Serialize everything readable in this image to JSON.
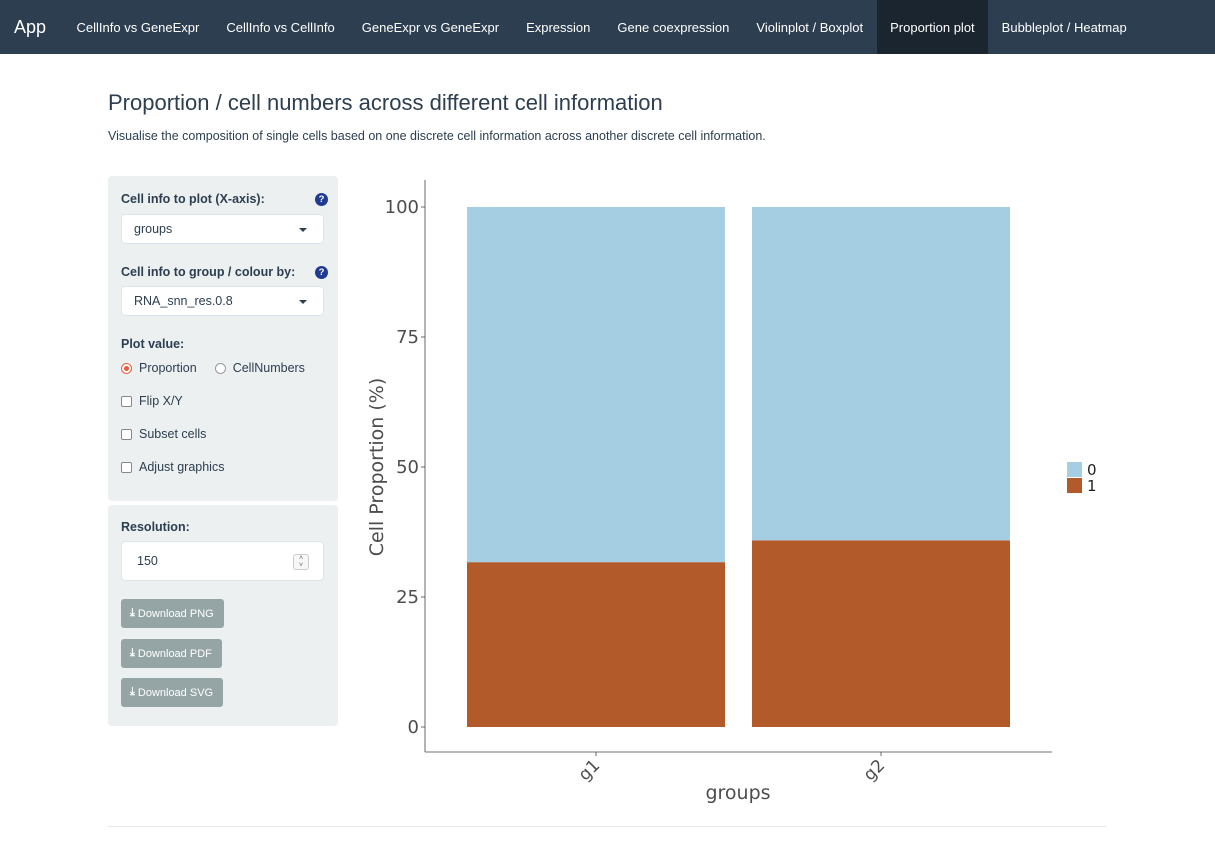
{
  "navbar": {
    "brand": "App",
    "items": [
      {
        "label": "CellInfo vs GeneExpr",
        "active": false
      },
      {
        "label": "CellInfo vs CellInfo",
        "active": false
      },
      {
        "label": "GeneExpr vs GeneExpr",
        "active": false
      },
      {
        "label": "Expression",
        "active": false
      },
      {
        "label": "Gene coexpression",
        "active": false
      },
      {
        "label": "Violinplot / Boxplot",
        "active": false
      },
      {
        "label": "Proportion plot",
        "active": true
      },
      {
        "label": "Bubbleplot / Heatmap",
        "active": false
      }
    ]
  },
  "header": {
    "title": "Proportion / cell numbers across different cell information",
    "subtitle": "Visualise the composition of single cells based on one discrete cell information across another discrete cell information."
  },
  "sidebar": {
    "x_axis_label": "Cell info to plot (X-axis):",
    "x_axis_value": "groups",
    "group_label": "Cell info to group / colour by:",
    "group_value": "RNA_snn_res.0.8",
    "help_glyph": "?",
    "plot_value_label": "Plot value:",
    "radio_options": [
      {
        "label": "Proportion",
        "checked": true
      },
      {
        "label": "CellNumbers",
        "checked": false
      }
    ],
    "checkboxes": [
      {
        "label": "Flip X/Y",
        "checked": false
      },
      {
        "label": "Subset cells",
        "checked": false
      },
      {
        "label": "Adjust graphics",
        "checked": false
      }
    ],
    "resolution_label": "Resolution:",
    "resolution_value": "150",
    "download_buttons": [
      "Download PNG",
      "Download PDF",
      "Download SVG"
    ],
    "download_icon": "download-icon"
  },
  "chart_data": {
    "type": "bar",
    "stacked": true,
    "categories": [
      "g1",
      "g2"
    ],
    "series": [
      {
        "name": "1",
        "values": [
          31.7,
          35.9
        ],
        "color": "#b35a2a"
      },
      {
        "name": "0",
        "values": [
          68.3,
          64.1
        ],
        "color": "#a6cee3"
      }
    ],
    "xlabel": "groups",
    "ylabel": "Cell Proportion (%)",
    "ylim": [
      0,
      100
    ],
    "yticks": [
      0,
      25,
      50,
      75,
      100
    ],
    "legend_entries": [
      "0",
      "1"
    ],
    "legend_position": "right",
    "grid": false
  }
}
